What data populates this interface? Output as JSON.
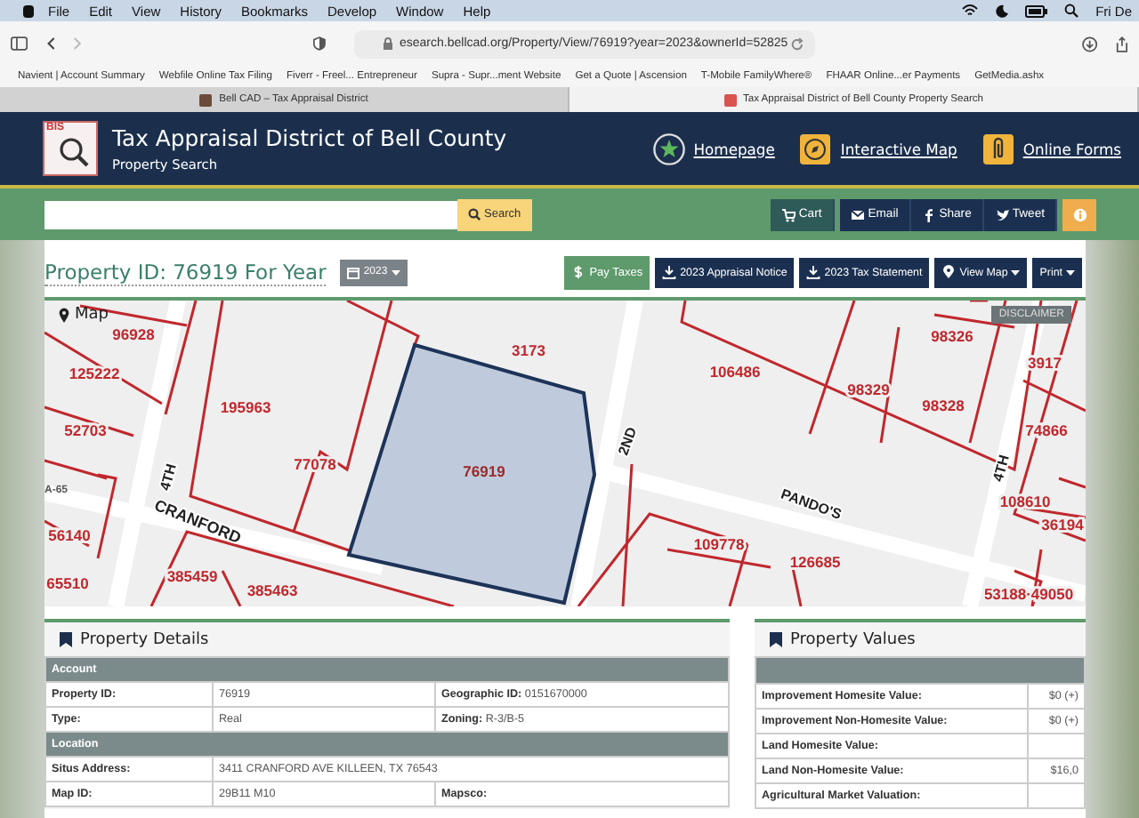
{
  "menu_bar": {
    "items": [
      "File",
      "Edit",
      "View",
      "History",
      "Bookmarks",
      "Develop",
      "Window",
      "Help"
    ],
    "clock": "Fri De"
  },
  "toolbar": {
    "url": "esearch.bellcad.org/Property/View/76919?year=2023&ownerId=52825"
  },
  "bookmarks": [
    "Navient | Account Summary",
    "Webfile Online Tax Filing",
    "Fiverr - Freel... Entrepreneur",
    "Supra - Supr...ment Website",
    "Get a Quote | Ascension",
    "T-Mobile FamilyWhere®",
    "FHAAR Online...er Payments",
    "GetMedia.ashx"
  ],
  "tabs": [
    {
      "title": "Bell CAD – Tax Appraisal District",
      "selected": false
    },
    {
      "title": "Tax Appraisal District of Bell County Property Search",
      "selected": true
    }
  ],
  "site_header": {
    "logo_text": "BIS",
    "title": "Tax Appraisal District of Bell County",
    "subtitle": "Property Search",
    "nav": [
      {
        "label": "Homepage",
        "kind": "star"
      },
      {
        "label": "Interactive Map",
        "kind": "compass"
      },
      {
        "label": "Online Forms",
        "kind": "clip"
      }
    ]
  },
  "search_bar": {
    "button": "Search",
    "actions": [
      {
        "label": "Cart",
        "kind": "cart"
      },
      {
        "label": "Email",
        "kind": "mail"
      },
      {
        "label": "Share",
        "kind": "facebook"
      },
      {
        "label": "Tweet",
        "kind": "twitter"
      }
    ]
  },
  "property_header": {
    "title": "Property ID: 76919 For Year",
    "year": "2023",
    "buttons": [
      {
        "label": "Pay Taxes",
        "kind": "pay"
      },
      {
        "label": "2023 Appraisal Notice",
        "kind": "download"
      },
      {
        "label": "2023 Tax Statement",
        "kind": "download"
      },
      {
        "label": "View Map",
        "kind": "map-dropdown"
      },
      {
        "label": "Print",
        "kind": "dropdown"
      }
    ]
  },
  "map": {
    "title": "Map",
    "disclaimer": "DISCLAIMER",
    "parcels": [
      {
        "label": "96928",
        "selected": false
      },
      {
        "label": "125222",
        "selected": false
      },
      {
        "label": "52703",
        "selected": false
      },
      {
        "label": "56140",
        "selected": false
      },
      {
        "label": "65510",
        "selected": false
      },
      {
        "label": "385459",
        "selected": false
      },
      {
        "label": "385463",
        "selected": false
      },
      {
        "label": "195963",
        "selected": false
      },
      {
        "label": "77078",
        "selected": false
      },
      {
        "label": "76919",
        "selected": true
      },
      {
        "label": "3173",
        "selected": false
      },
      {
        "label": "106486",
        "selected": false
      },
      {
        "label": "98329",
        "selected": false
      },
      {
        "label": "98328",
        "selected": false
      },
      {
        "label": "98326",
        "selected": false
      },
      {
        "label": "3917",
        "selected": false
      },
      {
        "label": "74866",
        "selected": false
      },
      {
        "label": "108610",
        "selected": false
      },
      {
        "label": "36194",
        "selected": false
      },
      {
        "label": "109778",
        "selected": false
      },
      {
        "label": "126685",
        "selected": false
      },
      {
        "label": "53188·49050",
        "selected": false
      }
    ],
    "streets": [
      "A-65",
      "CRANFORD",
      "4TH",
      "2ND",
      "PANDO'S",
      "4TH"
    ]
  },
  "property_details": {
    "title": "Property Details",
    "sections": [
      {
        "heading": "Account",
        "rows": [
          {
            "label": "Property ID:",
            "value": "76919",
            "extra": "**Geographic ID:** 0151670000"
          },
          {
            "label": "Type:",
            "value": "Real",
            "extra": "**Zoning:** R-3/B-5"
          }
        ]
      },
      {
        "heading": "Location",
        "rows": [
          {
            "label": "Situs Address:",
            "value": "3411 CRANFORD AVE   KILLEEN, TX 76543"
          },
          {
            "label": "Map ID:",
            "value": "29B11 M10",
            "extra": "**Mapsco:**"
          }
        ]
      }
    ]
  },
  "property_values": {
    "title": "Property Values",
    "rows": [
      {
        "label": "Improvement Homesite Value:",
        "value": "$0 (+)"
      },
      {
        "label": "Improvement Non-Homesite Value:",
        "value": "$0 (+)"
      },
      {
        "label": "Land Homesite Value:"
      },
      {
        "label": "Land Non-Homesite Value:",
        "value": "$16,0"
      },
      {
        "label": "Agricultural Market Valuation:"
      }
    ]
  }
}
